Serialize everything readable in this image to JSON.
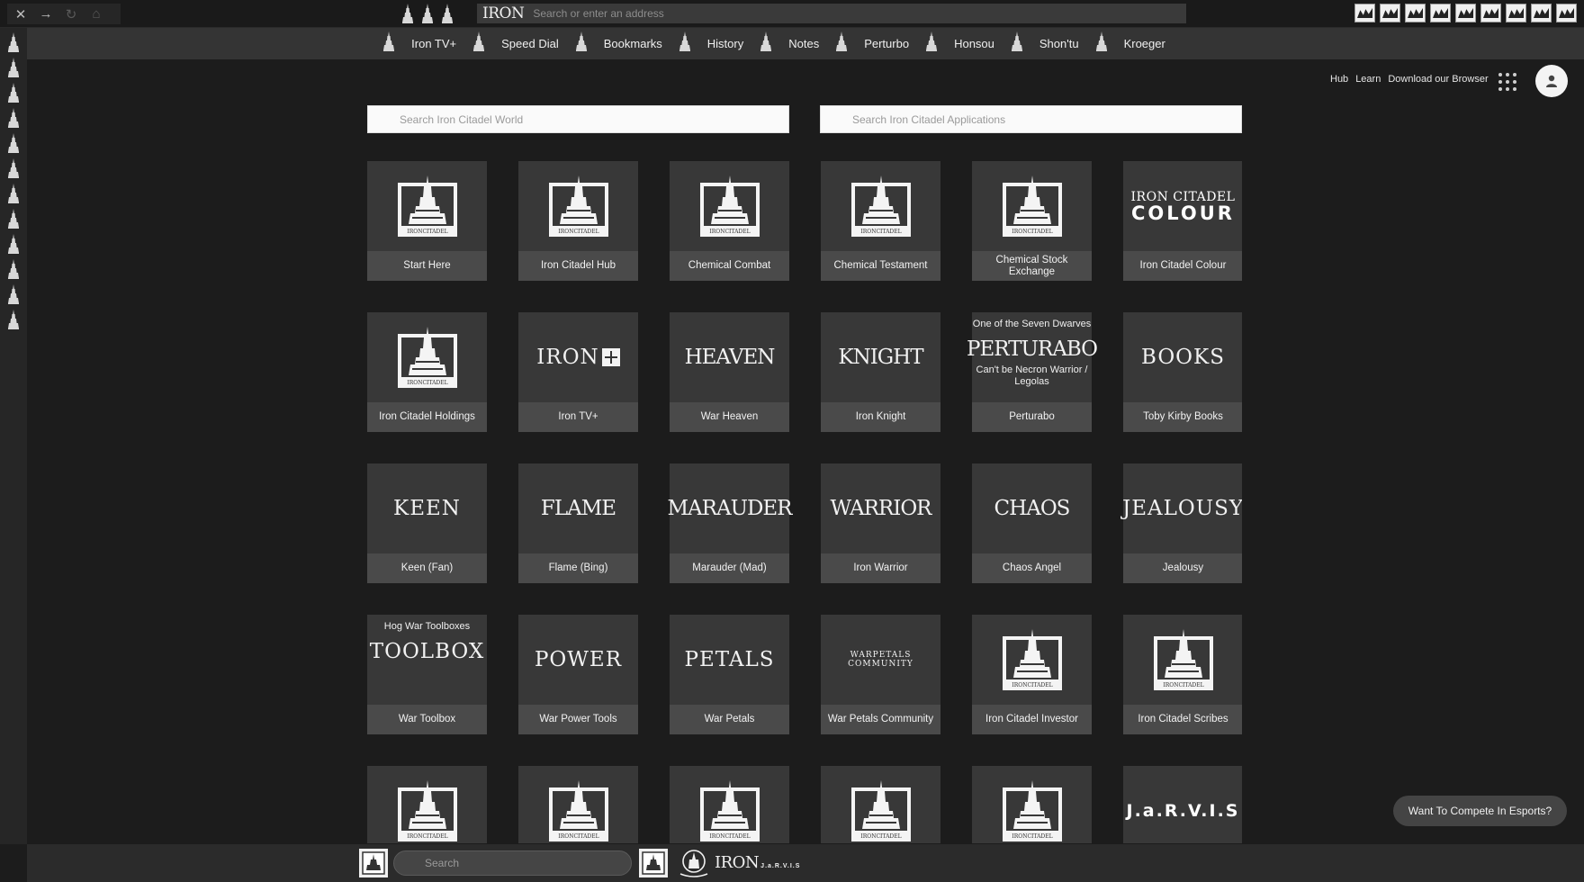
{
  "browser": {
    "brand": "IRON",
    "address_placeholder": "Search or enter an address",
    "extension_count": 9
  },
  "bookmarks": [
    {
      "label": "Iron TV+"
    },
    {
      "label": "Speed Dial"
    },
    {
      "label": "Bookmarks"
    },
    {
      "label": "History"
    },
    {
      "label": "Notes"
    },
    {
      "label": "Perturbo"
    },
    {
      "label": "Honsou"
    },
    {
      "label": "Shon'tu"
    },
    {
      "label": "Kroeger"
    }
  ],
  "top_links": {
    "hub": "Hub",
    "learn": "Learn",
    "download": "Download our Browser"
  },
  "search": {
    "world_placeholder": "Search Iron Citadel World",
    "apps_placeholder": "Search Iron Citadel Applications"
  },
  "tiles": [
    {
      "label": "Start Here",
      "art": "citadel"
    },
    {
      "label": "Iron Citadel Hub",
      "art": "citadel"
    },
    {
      "label": "Chemical Combat",
      "art": "citadel"
    },
    {
      "label": "Chemical Testament",
      "art": "citadel"
    },
    {
      "label": "Chemical Stock Exchange",
      "art": "citadel"
    },
    {
      "label": "Iron Citadel Colour",
      "art": "colour",
      "art_line1": "IRON CITADEL",
      "art_line2": "COLOUR"
    },
    {
      "label": "Iron Citadel Holdings",
      "art": "citadel"
    },
    {
      "label": "Iron TV+",
      "art": "ironplus",
      "word": "IRON"
    },
    {
      "label": "War Heaven",
      "art": "word",
      "word": "HEAVEN",
      "narrow": true
    },
    {
      "label": "Iron Knight",
      "art": "word",
      "word": "KNIGHT",
      "narrow": true
    },
    {
      "label": "Perturabo",
      "art": "word",
      "super": "One of the Seven Dwarves",
      "word": "PERTURABO",
      "sub": "Can't be Necron Warrior / Legolas",
      "narrow": true
    },
    {
      "label": "Toby Kirby Books",
      "art": "word",
      "word": "BOOKS"
    },
    {
      "label": "Keen (Fan)",
      "art": "word",
      "word": "KEEN"
    },
    {
      "label": "Flame (Bing)",
      "art": "word",
      "word": "FLAME",
      "narrow": true
    },
    {
      "label": "Marauder (Mad)",
      "art": "word",
      "word": "MARAUDER",
      "narrow": true
    },
    {
      "label": "Iron Warrior",
      "art": "word",
      "word": "WARRIOR",
      "narrow": true
    },
    {
      "label": "Chaos Angel",
      "art": "word",
      "word": "CHAOS",
      "narrow": true
    },
    {
      "label": "Jealousy",
      "art": "word",
      "word": "JEALOUSY"
    },
    {
      "label": "War Toolbox",
      "art": "word",
      "super": "Hog War Toolboxes",
      "word": "TOOLBOX"
    },
    {
      "label": "War Power Tools",
      "art": "word",
      "word": "POWER"
    },
    {
      "label": "War Petals",
      "art": "word",
      "word": "PETALS"
    },
    {
      "label": "War Petals Community",
      "art": "small",
      "word": "WARPETALS COMMUNITY"
    },
    {
      "label": "Iron Citadel Investor",
      "art": "citadel"
    },
    {
      "label": "Iron Citadel Scribes",
      "art": "citadel"
    },
    {
      "label": "",
      "art": "citadel"
    },
    {
      "label": "",
      "art": "citadel"
    },
    {
      "label": "",
      "art": "citadel"
    },
    {
      "label": "",
      "art": "citadel"
    },
    {
      "label": "",
      "art": "citadel"
    },
    {
      "label": "",
      "art": "jarvis",
      "word": "J.a.R.V.I.S"
    }
  ],
  "citadel_logo_text": "IRONCITADEL",
  "bottom_bar": {
    "search_placeholder": "Search",
    "brand_a": "IRON",
    "brand_b": "J.a.R.V.I.S"
  },
  "esports_button": "Want To Compete In Esports?"
}
